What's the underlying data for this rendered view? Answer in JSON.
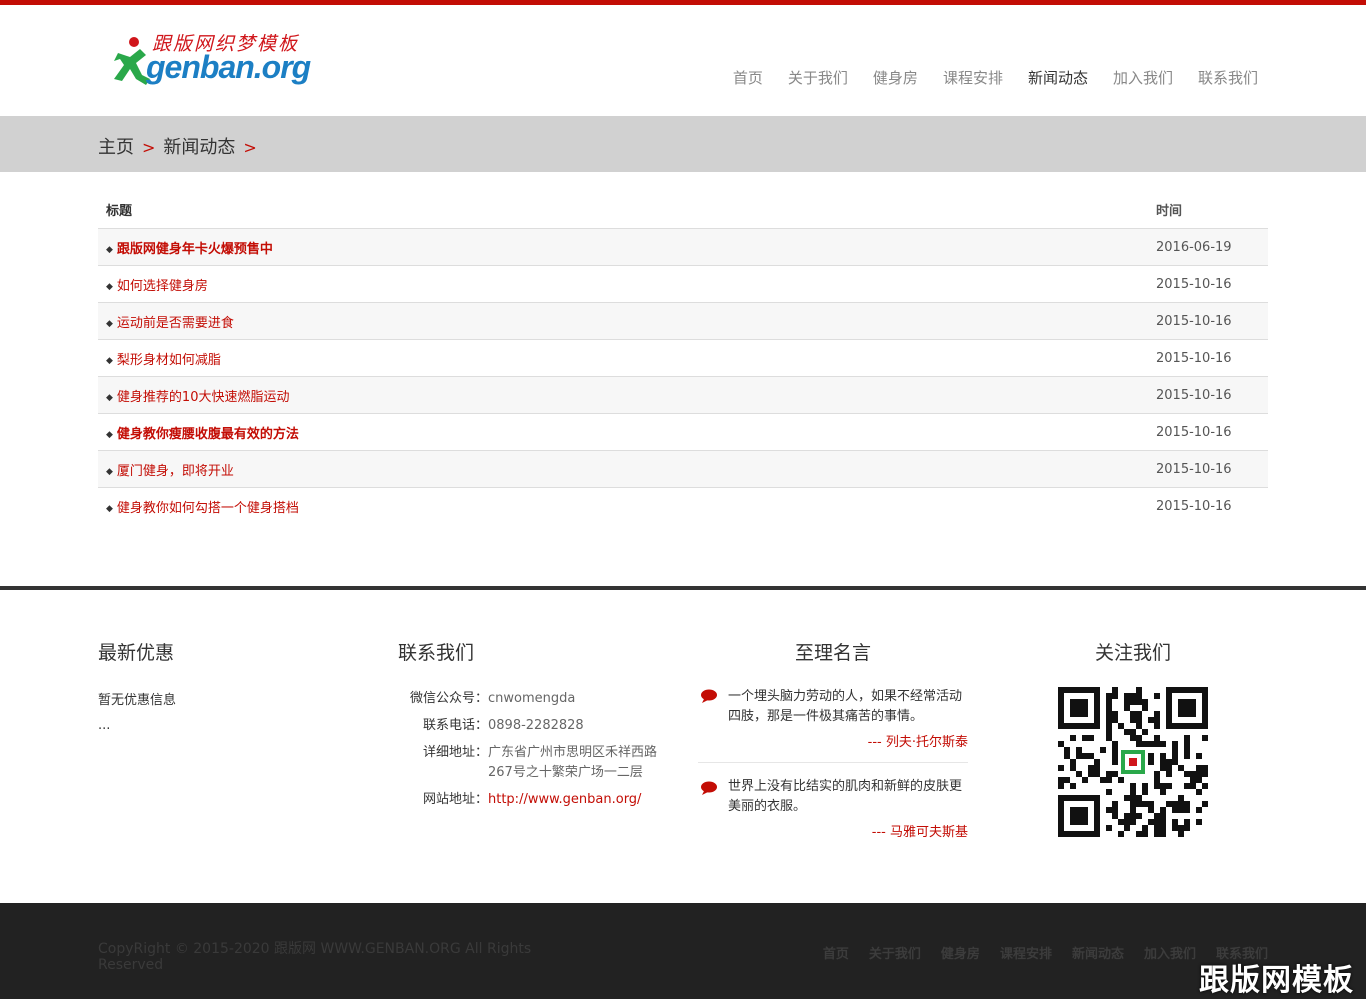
{
  "logo": {
    "tagline": "跟版网织梦模板",
    "domain": "genban.org"
  },
  "nav": [
    {
      "label": "首页",
      "active": false
    },
    {
      "label": "关于我们",
      "active": false
    },
    {
      "label": "健身房",
      "active": false
    },
    {
      "label": "课程安排",
      "active": false
    },
    {
      "label": "新闻动态",
      "active": true
    },
    {
      "label": "加入我们",
      "active": false
    },
    {
      "label": "联系我们",
      "active": false
    }
  ],
  "breadcrumb": {
    "home": "主页",
    "sep": ">",
    "current": "新闻动态"
  },
  "news": {
    "header_title": "标题",
    "header_time": "时间",
    "rows": [
      {
        "title": "跟版网健身年卡火爆预售中",
        "date": "2016-06-19",
        "bold": true
      },
      {
        "title": "如何选择健身房",
        "date": "2015-10-16",
        "bold": false
      },
      {
        "title": "运动前是否需要进食",
        "date": "2015-10-16",
        "bold": false
      },
      {
        "title": "梨形身材如何减脂",
        "date": "2015-10-16",
        "bold": false
      },
      {
        "title": "健身推荐的10大快速燃脂运动",
        "date": "2015-10-16",
        "bold": false
      },
      {
        "title": "健身教你瘦腰收腹最有效的方法",
        "date": "2015-10-16",
        "bold": true
      },
      {
        "title": "厦门健身，即将开业",
        "date": "2015-10-16",
        "bold": false
      },
      {
        "title": "健身教你如何勾搭一个健身搭档",
        "date": "2015-10-16",
        "bold": false
      }
    ]
  },
  "footer": {
    "promo": {
      "title": "最新优惠",
      "line1": "暂无优惠信息",
      "line2": "..."
    },
    "contact": {
      "title": "联系我们",
      "items": [
        {
          "label": "微信公众号：",
          "value": "cnwomengda"
        },
        {
          "label": "联系电话：",
          "value": "0898-2282828"
        },
        {
          "label": "详细地址：",
          "value": "广东省广州市思明区禾祥西路267号之十繁荣广场一二层"
        },
        {
          "label": "网站地址：",
          "value": "http://www.genban.org/"
        }
      ]
    },
    "quotes": {
      "title": "至理名言",
      "items": [
        {
          "text": "一个埋头脑力劳动的人，如果不经常活动四肢，那是一件极其痛苦的事情。",
          "author": "--- 列夫·托尔斯泰"
        },
        {
          "text": "世界上没有比结实的肌肉和新鲜的皮肤更美丽的衣服。",
          "author": "--- 马雅可夫斯基"
        }
      ]
    },
    "follow": {
      "title": "关注我们"
    }
  },
  "bottom": {
    "copyright": "CopyRight © 2015-2020 跟版网 WWW.GENBAN.ORG All Rights Reserved",
    "nav": [
      "首页",
      "关于我们",
      "健身房",
      "课程安排",
      "新闻动态",
      "加入我们",
      "联系我们"
    ],
    "watermark": "跟版网模板"
  },
  "colors": {
    "accent": "#c30d05",
    "crumb_bg": "#d1d1d1",
    "bottom_bg": "#222222"
  }
}
